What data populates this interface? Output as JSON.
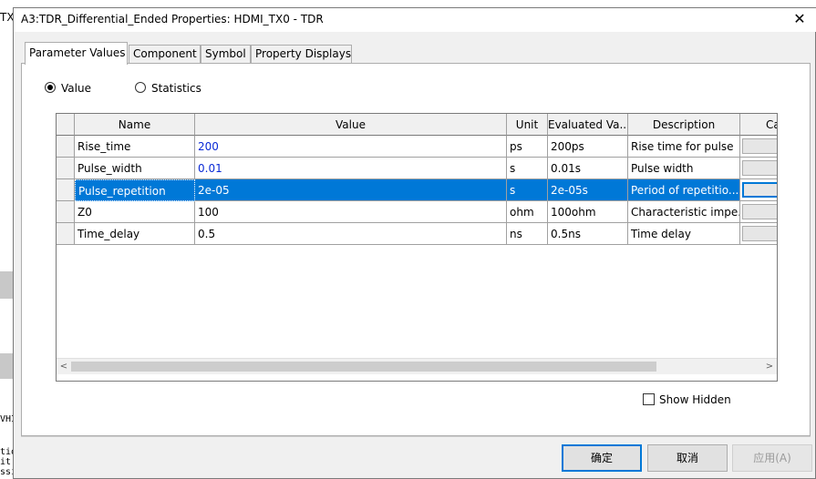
{
  "background": {
    "left_label": "TX",
    "fragments": [
      "tio",
      "it",
      "ssi"
    ],
    "side_label": "VHI"
  },
  "dialog": {
    "title": "A3:TDR_Differential_Ended Properties: HDMI_TX0 - TDR",
    "close_glyph": "✕"
  },
  "tabs": [
    {
      "label": "Parameter Values",
      "active": true
    },
    {
      "label": "Component",
      "active": false
    },
    {
      "label": "Symbol",
      "active": false
    },
    {
      "label": "Property Displays",
      "active": false
    }
  ],
  "mode": {
    "value_label": "Value",
    "statistics_label": "Statistics",
    "selected": "Value"
  },
  "table": {
    "columns": [
      "Name",
      "Value",
      "Unit",
      "Evaluated Va...",
      "Description",
      "Ca"
    ],
    "rows": [
      {
        "name": "Rise_time",
        "value": "200",
        "unit": "ps",
        "evaluated": "200ps",
        "description": "Rise time for pulse",
        "value_color": "#0a2ad6"
      },
      {
        "name": "Pulse_width",
        "value": "0.01",
        "unit": "s",
        "evaluated": "0.01s",
        "description": "Pulse width",
        "value_color": "#0a2ad6"
      },
      {
        "name": "Pulse_repetition",
        "value": "2e-05",
        "unit": "s",
        "evaluated": "2e-05s",
        "description": "Period of repetitio...",
        "selected": true
      },
      {
        "name": "Z0",
        "value": "100",
        "unit": "ohm",
        "evaluated": "100ohm",
        "description": "Characteristic impe..."
      },
      {
        "name": "Time_delay",
        "value": "0.5",
        "unit": "ns",
        "evaluated": "0.5ns",
        "description": "Time delay"
      }
    ],
    "scroll_left": "<",
    "scroll_right": ">"
  },
  "show_hidden": {
    "label": "Show Hidden",
    "checked": false
  },
  "buttons": {
    "ok": "确定",
    "cancel": "取消",
    "apply": "应用(A)"
  },
  "colors": {
    "selection": "#0078d7",
    "value_blue": "#0a2ad6"
  }
}
